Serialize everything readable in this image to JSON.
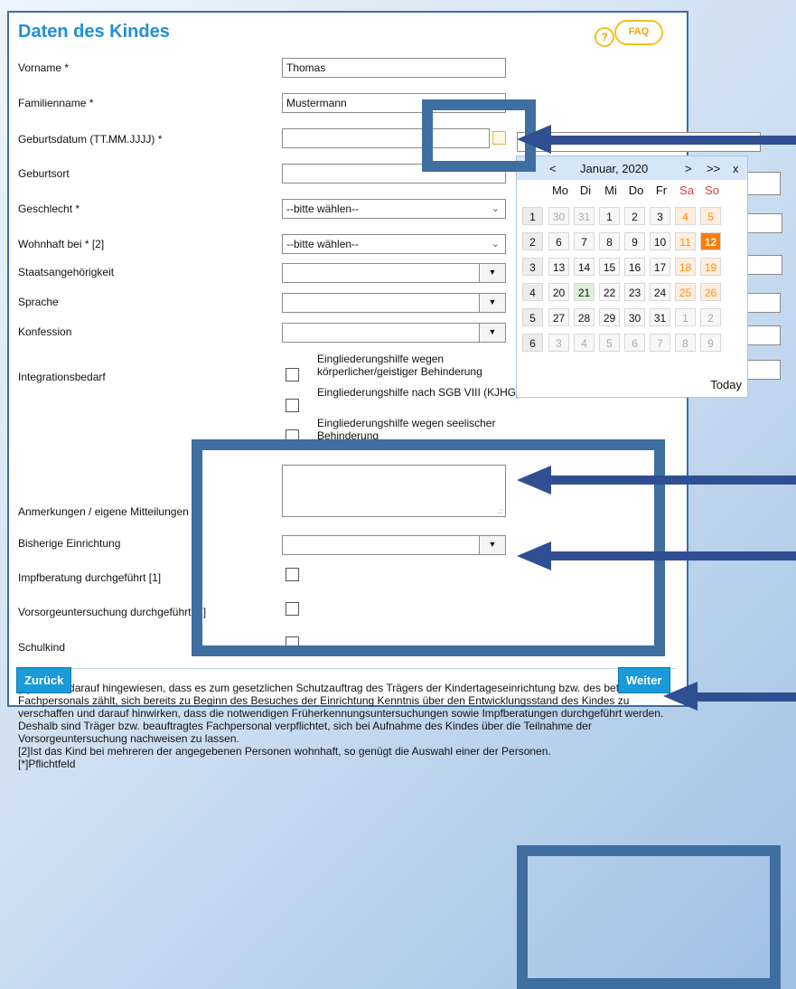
{
  "form": {
    "title": "Daten des Kindes",
    "faq_label": "FAQ",
    "faq_q": "?",
    "fields": [
      {
        "label": "Vorname *",
        "value": "Thomas"
      },
      {
        "label": "Familienname *",
        "value": "Mustermann"
      },
      {
        "label": "Geburtsdatum (TT.MM.JJJJ) *",
        "value": ""
      },
      {
        "label": "Geburtsort",
        "value": ""
      },
      {
        "label": "Geschlecht *",
        "value": "--bitte wählen--"
      },
      {
        "label": "Wohnhaft bei * [2]",
        "value": "--bitte wählen--"
      },
      {
        "label": "Staatsangehörigkeit",
        "value": ""
      },
      {
        "label": "Sprache",
        "value": ""
      },
      {
        "label": "Konfession",
        "value": ""
      }
    ],
    "integration": {
      "label": "Integrationsbedarf",
      "options": [
        "Eingliederungshilfe wegen körperlicher/geistiger Behinderung",
        "Eingliederungshilfe nach SGB VIII (KJHG)",
        "Eingliederungshilfe wegen seelischer Behinderung"
      ]
    },
    "anmerkungen_label": "Anmerkungen / eigene Mitteilungen",
    "bisherige_label": "Bisherige Einrichtung",
    "impf_label": "Impfberatung durchgeführt [1]",
    "vorsorge_label": "Vorsorgeuntersuchung durchgeführt [1]",
    "schulkind_label": "Schulkind"
  },
  "footnotes": [
    "[1]Es wird darauf hingewiesen, dass es zum gesetzlichen Schutzauftrag des Trägers der Kindertageseinrichtung bzw. des betreuenden Fachpersonals zählt, sich bereits zu Beginn des Besuches der Einrichtung Kenntnis über den Entwicklungsstand des Kindes zu verschaffen und darauf hinwirken, dass die notwendigen Früherkennungsuntersuchungen sowie Impfberatungen durchgeführt werden. Deshalb sind Träger bzw. beauftragtes Fachpersonal verpflichtet, sich bei Aufnahme des Kindes über die Teilnahme der Vorsorgeuntersuchung nachweisen zu lassen.",
    "[2]Ist das Kind bei mehreren der angegebenen Personen wohnhaft, so genügt die Auswahl einer der Personen.",
    "[*]Pflichtfeld"
  ],
  "buttons": {
    "back": "Zurück",
    "next": "Weiter"
  },
  "calendar": {
    "prev_year": "<<",
    "prev": "<",
    "month": "Januar, 2020",
    "next": ">",
    "next_year": ">>",
    "close": "x",
    "days": [
      "Mo",
      "Di",
      "Mi",
      "Do",
      "Fr",
      "Sa",
      "So"
    ],
    "weeks": [
      {
        "wk": "1",
        "days": [
          "30",
          "31",
          "1",
          "2",
          "3",
          "4",
          "5"
        ]
      },
      {
        "wk": "2",
        "days": [
          "6",
          "7",
          "8",
          "9",
          "10",
          "11",
          "12"
        ]
      },
      {
        "wk": "3",
        "days": [
          "13",
          "14",
          "15",
          "16",
          "17",
          "18",
          "19"
        ]
      },
      {
        "wk": "4",
        "days": [
          "20",
          "21",
          "22",
          "23",
          "24",
          "25",
          "26"
        ]
      },
      {
        "wk": "5",
        "days": [
          "27",
          "28",
          "29",
          "30",
          "31",
          "1",
          "2"
        ]
      },
      {
        "wk": "6",
        "days": [
          "3",
          "4",
          "5",
          "6",
          "7",
          "8",
          "9"
        ]
      }
    ],
    "today_label": "Today",
    "colors": {
      "weekend": "#ff8c1a",
      "selected_bg": "#ff7a00",
      "today_bg": "#dff0d8"
    }
  }
}
